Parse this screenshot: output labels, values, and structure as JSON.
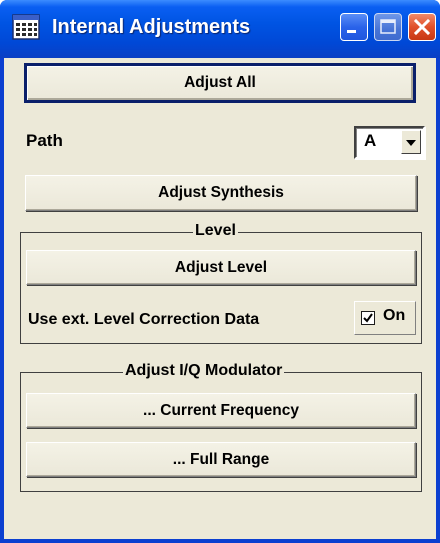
{
  "window": {
    "title": "Internal Adjustments",
    "icon": "calculator-window-icon",
    "controls": [
      "minimize-icon",
      "maximize-icon",
      "close-icon"
    ]
  },
  "main": {
    "adjust_all_label": "Adjust All",
    "path_label": "Path",
    "path_select": {
      "value": "A"
    },
    "adjust_synthesis_label": "Adjust Synthesis"
  },
  "level_group": {
    "title": "Level",
    "adjust_level_label": "Adjust Level",
    "ext_correction_label": "Use ext. Level Correction Data",
    "ext_correction_checkbox": {
      "label": "On",
      "checked": true
    }
  },
  "iq_group": {
    "title": "Adjust I/Q Modulator",
    "current_frequency_label": "... Current Frequency",
    "full_range_label": "... Full Range"
  },
  "colors": {
    "titlebar_blue": "#0054e3",
    "dialog_face": "#ece9d8",
    "close_red": "#e0502a"
  }
}
